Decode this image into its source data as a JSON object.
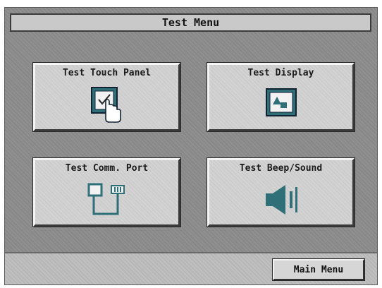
{
  "header": {
    "title": "Test Menu"
  },
  "buttons": [
    {
      "label": "Test Touch Panel",
      "icon": "touch-panel-icon"
    },
    {
      "label": "Test Display",
      "icon": "display-icon"
    },
    {
      "label": "Test Comm. Port",
      "icon": "comm-port-icon"
    },
    {
      "label": "Test Beep/Sound",
      "icon": "speaker-icon"
    }
  ],
  "footer": {
    "main_menu_label": "Main Menu"
  },
  "colors": {
    "screen_bg": "#8c8c8c",
    "button_face": "#d2d2d2",
    "icon_accent": "#2e6f78"
  }
}
